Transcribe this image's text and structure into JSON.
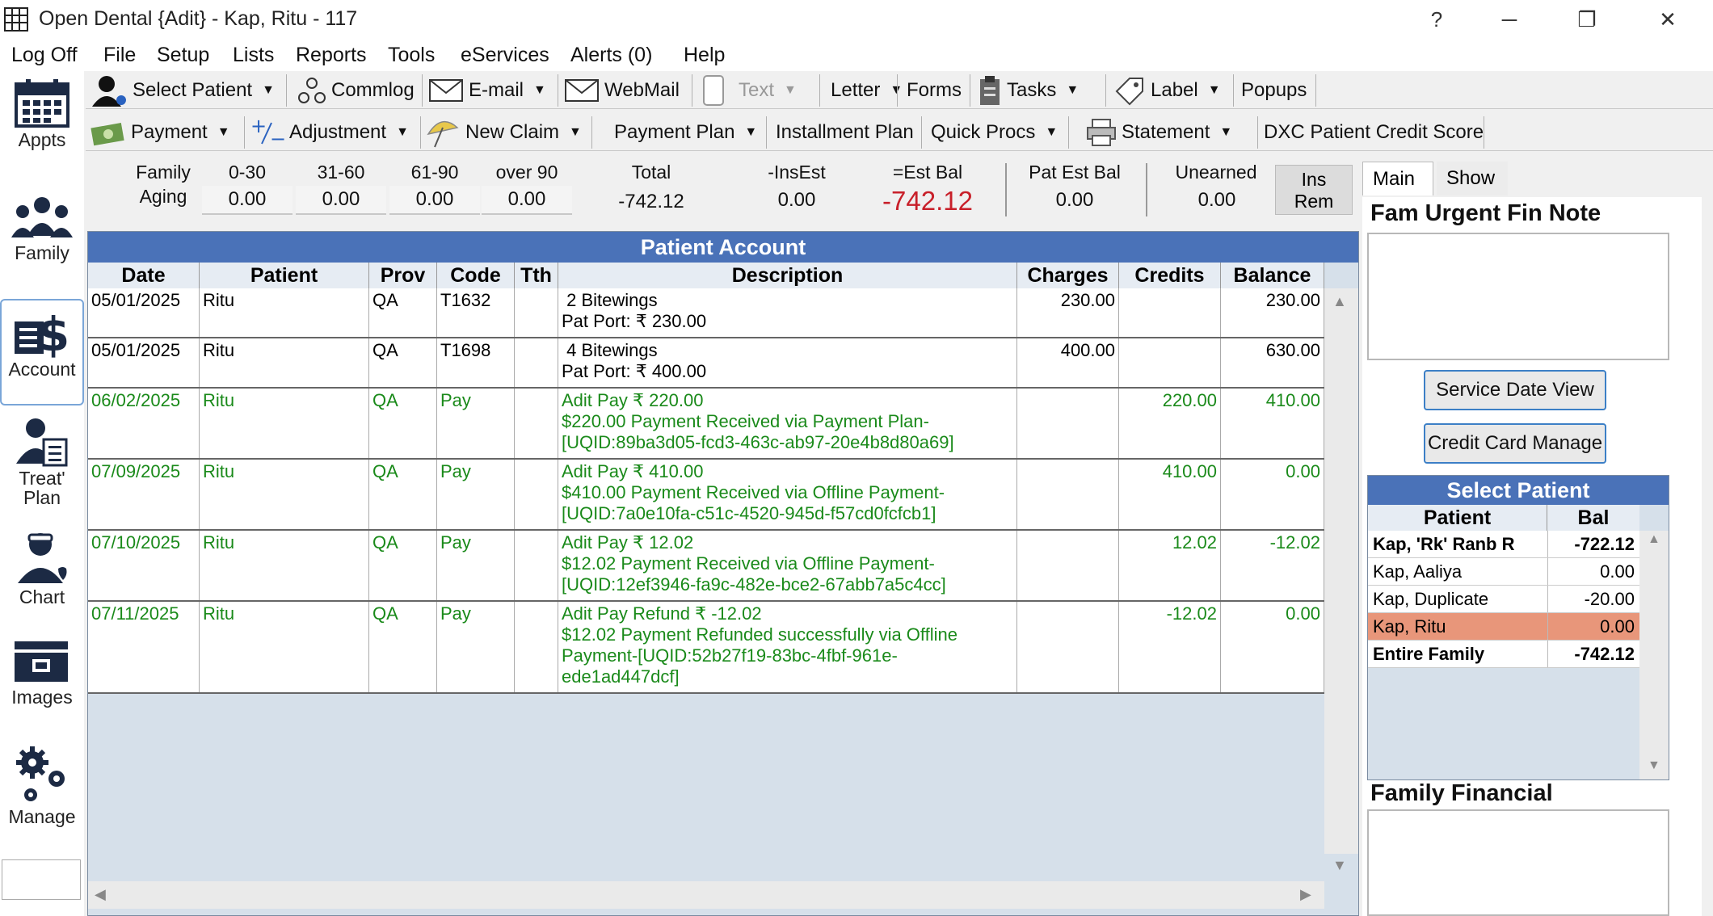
{
  "window": {
    "title": "Open Dental {Adit} - Kap, Ritu - 117",
    "help": "?",
    "minimize": "─",
    "restore": "❐",
    "close": "✕"
  },
  "menu": [
    "Log Off",
    "File",
    "Setup",
    "Lists",
    "Reports",
    "Tools",
    "eServices",
    "Alerts (0)",
    "Help"
  ],
  "nav": [
    {
      "label": "Appts",
      "icon": "calendar-icon"
    },
    {
      "label": "Family",
      "icon": "family-icon"
    },
    {
      "label": "Account",
      "icon": "account-dollar-icon"
    },
    {
      "label": "Treat'",
      "label2": "Plan",
      "icon": "treatplan-icon"
    },
    {
      "label": "Chart",
      "icon": "chart-doctor-icon"
    },
    {
      "label": "Images",
      "icon": "images-icon"
    },
    {
      "label": "Manage",
      "icon": "gears-icon"
    }
  ],
  "toolbar1": {
    "select_patient": "Select Patient",
    "commlog": "Commlog",
    "email": "E-mail",
    "webmail": "WebMail",
    "text": "Text",
    "letter": "Letter",
    "forms": "Forms",
    "tasks": "Tasks",
    "label": "Label",
    "popups": "Popups"
  },
  "toolbar2": {
    "payment": "Payment",
    "adjustment": "Adjustment",
    "new_claim": "New Claim",
    "payment_plan": "Payment Plan",
    "installment_plan": "Installment Plan",
    "quick_procs": "Quick Procs",
    "statement": "Statement",
    "dxc": "DXC Patient Credit Score"
  },
  "aging": {
    "family_label": "Family",
    "aging_label": "Aging",
    "cols": [
      {
        "label": "0-30",
        "value": "0.00"
      },
      {
        "label": "31-60",
        "value": "0.00"
      },
      {
        "label": "61-90",
        "value": "0.00"
      },
      {
        "label": "over 90",
        "value": "0.00"
      }
    ],
    "total_label": "Total",
    "total": "-742.12",
    "insest_label": "-InsEst",
    "insest": "0.00",
    "estbal_label": "=Est Bal",
    "estbal": "-742.12",
    "patestbal_label": "Pat Est Bal",
    "patestbal": "0.00",
    "unearned_label": "Unearned",
    "unearned": "0.00",
    "insrem_1": "Ins",
    "insrem_2": "Rem"
  },
  "account": {
    "title": "Patient Account",
    "columns": [
      "Date",
      "Patient",
      "Prov",
      "Code",
      "Tth",
      "Description",
      "Charges",
      "Credits",
      "Balance"
    ],
    "rows": [
      {
        "date": "05/01/2025",
        "patient": "Ritu",
        "prov": "QA",
        "code": "T1632",
        "tth": "",
        "desc": [
          " 2 Bitewings",
          "Pat Port: ₹ 230.00"
        ],
        "charges": "230.00",
        "credits": "",
        "balance": "230.00",
        "green": false
      },
      {
        "date": "05/01/2025",
        "patient": "Ritu",
        "prov": "QA",
        "code": "T1698",
        "tth": "",
        "desc": [
          " 4 Bitewings",
          "Pat Port: ₹ 400.00"
        ],
        "charges": "400.00",
        "credits": "",
        "balance": "630.00",
        "green": false
      },
      {
        "date": "06/02/2025",
        "patient": "Ritu",
        "prov": "QA",
        "code": "Pay",
        "tth": "",
        "desc": [
          "Adit Pay ₹ 220.00",
          "$220.00 Payment Received via Payment Plan-",
          "[UQID:89ba3d05-fcd3-463c-ab97-20e4b8d80a69]"
        ],
        "charges": "",
        "credits": "220.00",
        "balance": "410.00",
        "green": true
      },
      {
        "date": "07/09/2025",
        "patient": "Ritu",
        "prov": "QA",
        "code": "Pay",
        "tth": "",
        "desc": [
          "Adit Pay ₹ 410.00",
          "$410.00 Payment Received via Offline Payment-",
          "[UQID:7a0e10fa-c51c-4520-945d-f57cd0fcfcb1]"
        ],
        "charges": "",
        "credits": "410.00",
        "balance": "0.00",
        "green": true
      },
      {
        "date": "07/10/2025",
        "patient": "Ritu",
        "prov": "QA",
        "code": "Pay",
        "tth": "",
        "desc": [
          "Adit Pay ₹ 12.02",
          "$12.02 Payment Received via Offline Payment-",
          "[UQID:12ef3946-fa9c-482e-bce2-67abb7a5c4cc]"
        ],
        "charges": "",
        "credits": "12.02",
        "balance": "-12.02",
        "green": true
      },
      {
        "date": "07/11/2025",
        "patient": "Ritu",
        "prov": "QA",
        "code": "Pay",
        "tth": "",
        "desc": [
          "Adit Pay Refund ₹ -12.02",
          "$12.02 Payment Refunded successfully via Offline",
          "Payment-[UQID:52b27f19-83bc-4fbf-961e-",
          "ede1ad447dcf]"
        ],
        "charges": "",
        "credits": "-12.02",
        "balance": "0.00",
        "green": true
      }
    ]
  },
  "right": {
    "tab_main": "Main",
    "tab_show": "Show",
    "urgent_note_title": "Fam Urgent Fin Note",
    "service_date_view": "Service Date View",
    "credit_card_manage": "Credit Card Manage",
    "select_patient_title": "Select Patient",
    "sp_col_patient": "Patient",
    "sp_col_bal": "Bal",
    "patients": [
      {
        "name": "Kap, 'Rk' Ranb R",
        "bal": "-722.12",
        "bold": true
      },
      {
        "name": "Kap, Aaliya",
        "bal": "0.00",
        "bold": false
      },
      {
        "name": "Kap, Duplicate",
        "bal": "-20.00",
        "bold": false
      },
      {
        "name": "Kap, Ritu",
        "bal": "0.00",
        "bold": false,
        "selected": true
      },
      {
        "name": "Entire Family",
        "bal": "-742.12",
        "bold": true
      }
    ],
    "family_financial_title": "Family Financial"
  },
  "colors": {
    "header_blue": "#4a72b8",
    "payment_green": "#1a8a1a",
    "estbal_red": "#c8202a",
    "selected_row": "#e8967a"
  }
}
